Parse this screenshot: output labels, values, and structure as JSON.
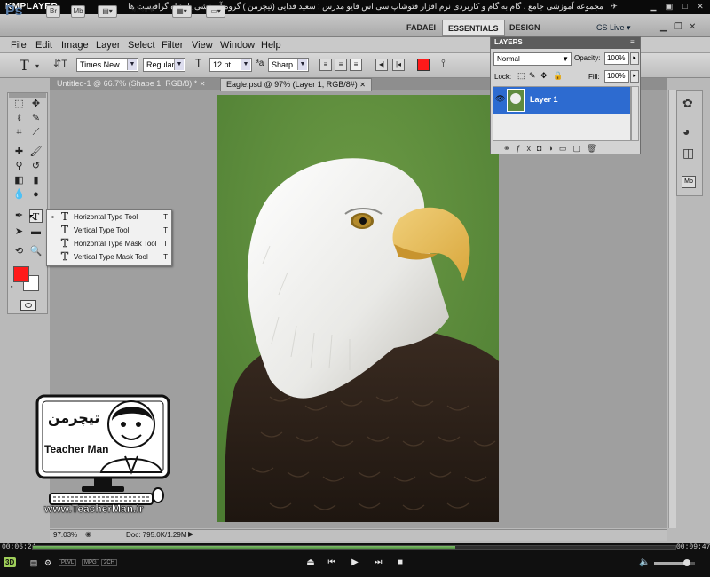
{
  "player": {
    "name": "KMPLAYER",
    "caption": "مجموعه آموزشی جامع ، گام به گام و کاربردی نرم افزار فتوشاپ سی اس فایو  مدرس : سعید فدایی (تیچرمن ) گروه آموزشی پادشاه گرافیست ها",
    "time_elapsed": "00:06:24",
    "time_total": "00:09:47",
    "progress": 0.657,
    "volume": 0.8,
    "mode_badges": [
      "3D",
      "PLVL",
      "MPG",
      "2CH"
    ]
  },
  "photoshop": {
    "logo": "Ps",
    "zoom_dropdown": "97%",
    "workspace_user": "FADAEI",
    "workspace_essentials": "ESSENTIALS",
    "workspace_design": "DESIGN",
    "cslive": "CS Live",
    "menu": [
      "File",
      "Edit",
      "Image",
      "Layer",
      "Select",
      "Filter",
      "View",
      "Window",
      "Help"
    ],
    "options": {
      "font_family": "Times New ...",
      "font_style": "Regular",
      "font_size": "12 pt",
      "antialias": "Sharp",
      "text_color": "#ff1a1a"
    },
    "tabs": [
      {
        "label": "Untitled-1 @ 66.7% (Shape 1, RGB/8) *",
        "active": false
      },
      {
        "label": "Eagle.psd @ 97% (Layer 1, RGB/8#)",
        "active": true
      }
    ],
    "flyout": [
      {
        "label": "Horizontal Type Tool",
        "key": "T",
        "icon": "T",
        "selected": true
      },
      {
        "label": "Vertical Type Tool",
        "key": "T",
        "icon": "T",
        "selected": false
      },
      {
        "label": "Horizontal Type Mask Tool",
        "key": "T",
        "icon": "T",
        "selected": false
      },
      {
        "label": "Vertical Type Mask Tool",
        "key": "T",
        "icon": "T",
        "selected": false
      }
    ],
    "foreground_color": "#ff1a1a",
    "background_color": "#ffffff",
    "layers_panel": {
      "title": "LAYERS",
      "blend_mode": "Normal",
      "opacity_label": "Opacity:",
      "opacity": "100%",
      "lock_label": "Lock:",
      "fill_label": "Fill:",
      "fill": "100%",
      "layer_name": "Layer 1"
    },
    "status": {
      "zoom": "97.03%",
      "doc": "Doc: 795.0K/1.29M"
    }
  },
  "watermark": {
    "site": "www.TeacherMan.ir",
    "brand_en": "Teacher Man",
    "brand_fa": "تیچرمن"
  }
}
